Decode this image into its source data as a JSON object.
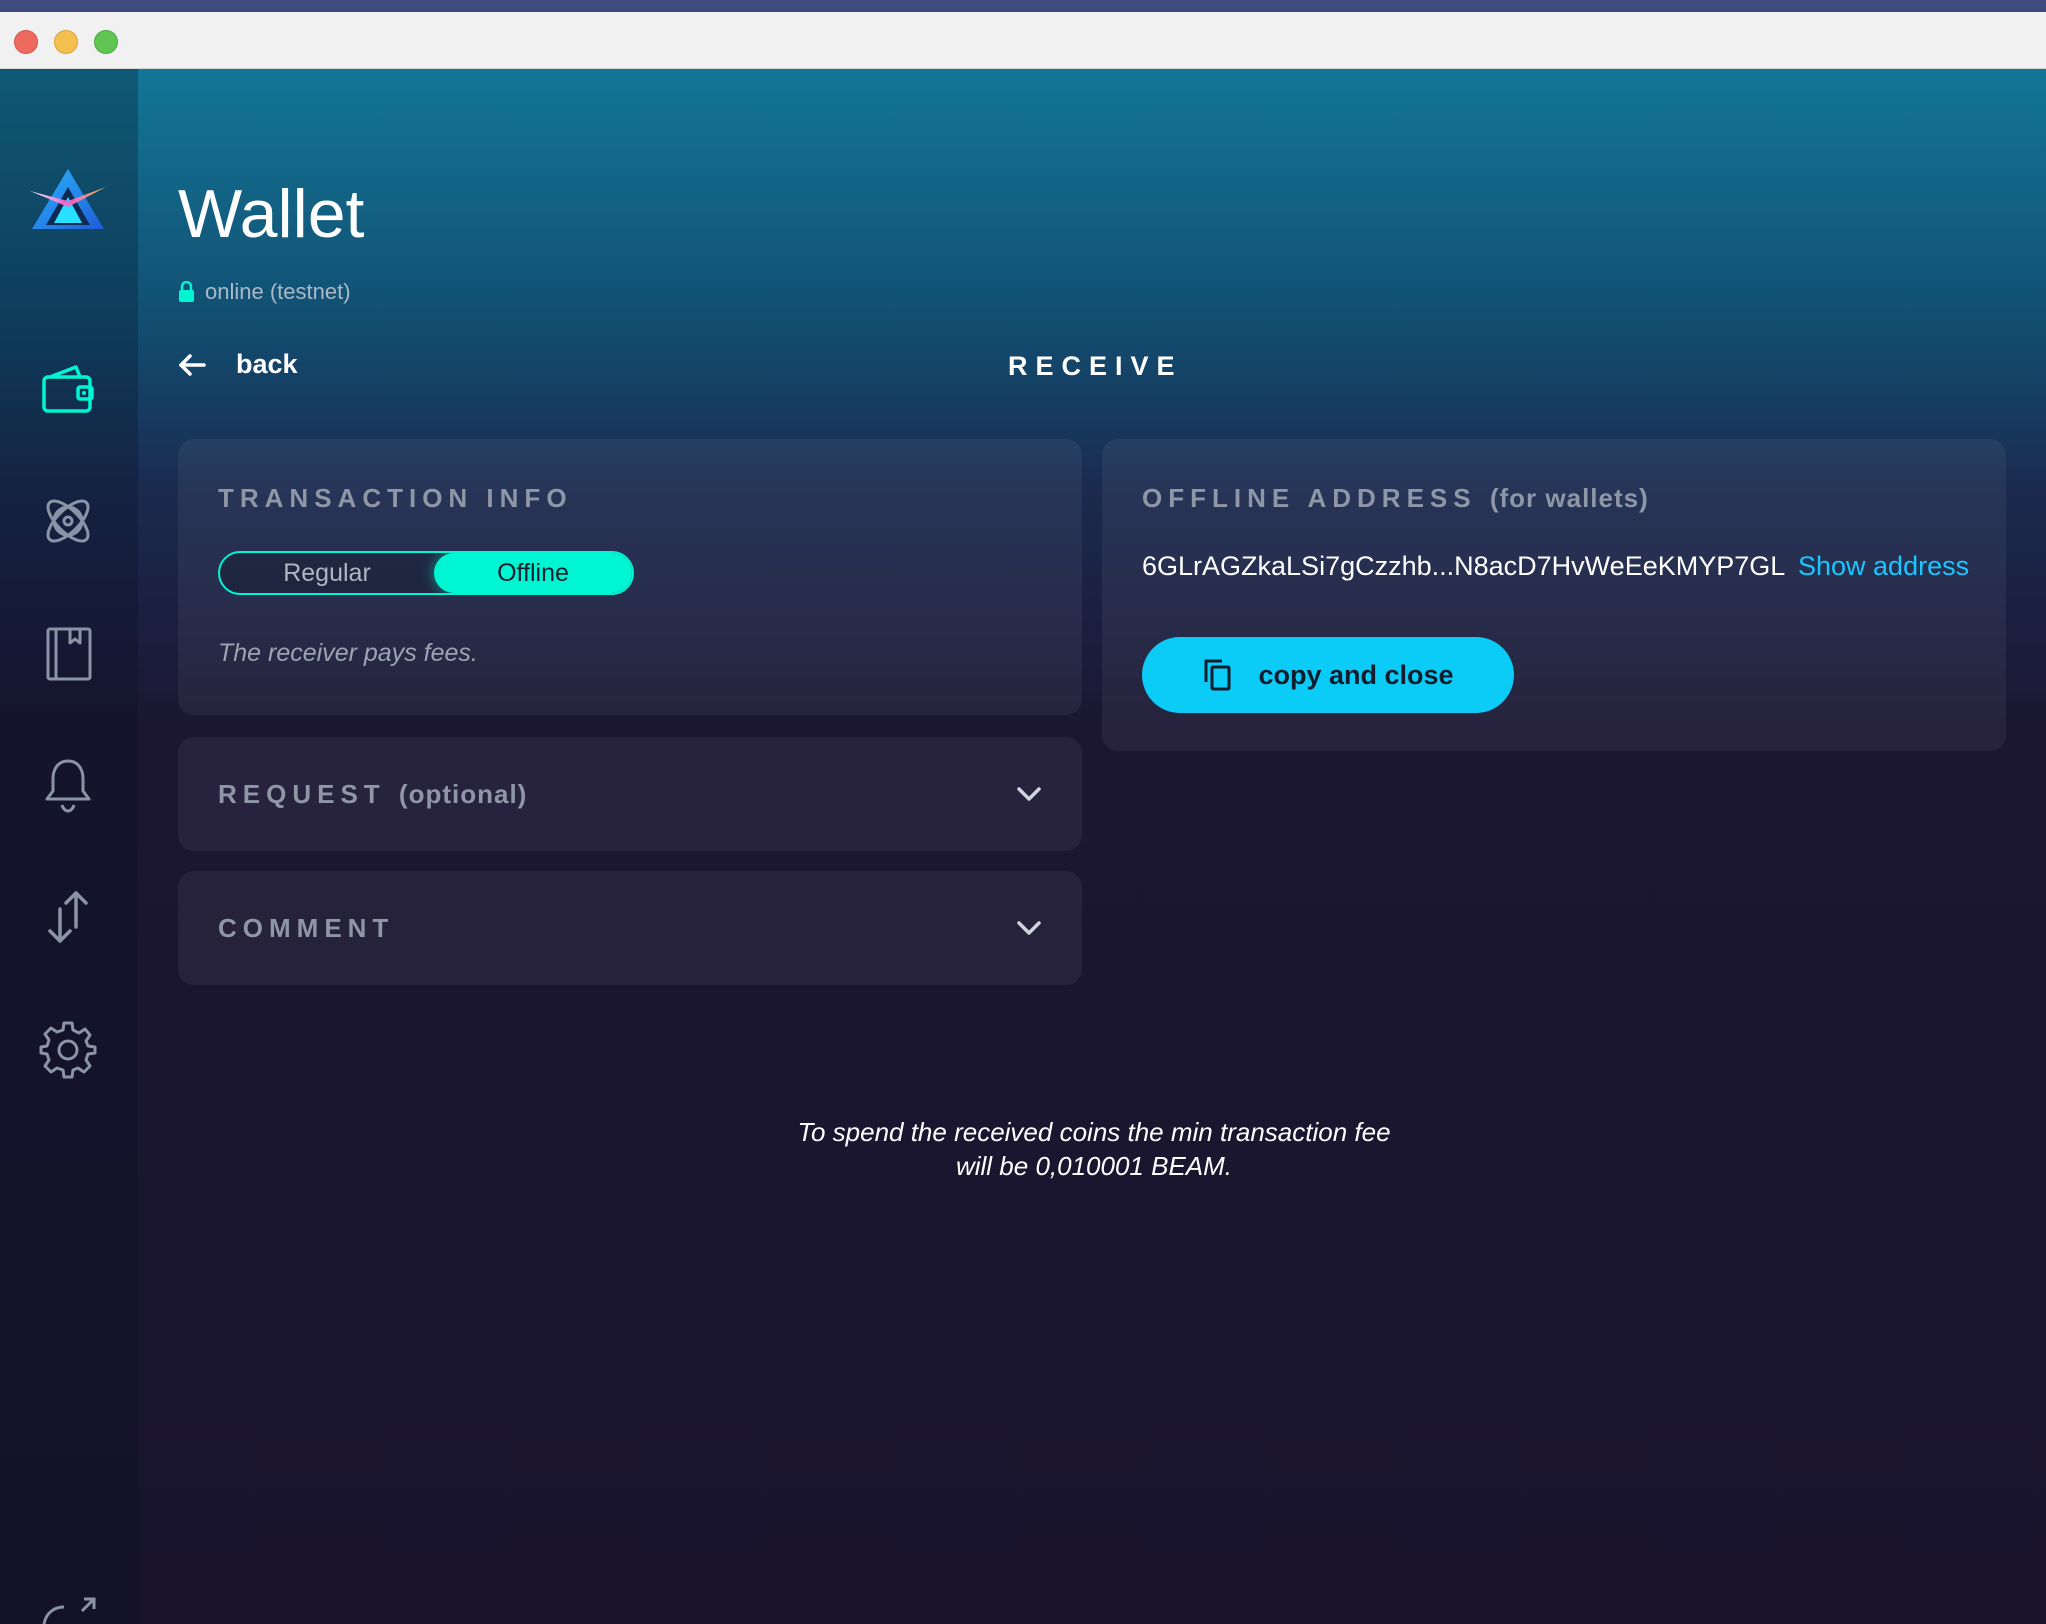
{
  "header": {
    "title": "Wallet",
    "status": "online (testnet)"
  },
  "nav": {
    "back_label": "back",
    "page_heading": "RECEIVE"
  },
  "sidebar": {
    "items": [
      {
        "icon": "wallet-icon",
        "active": true
      },
      {
        "icon": "atom-icon",
        "active": false
      },
      {
        "icon": "address-book-icon",
        "active": false
      },
      {
        "icon": "bell-icon",
        "active": false
      },
      {
        "icon": "transfer-arrows-icon",
        "active": false
      },
      {
        "icon": "gear-icon",
        "active": false
      }
    ]
  },
  "transaction_info": {
    "title": "TRANSACTION INFO",
    "toggle": {
      "options": [
        "Regular",
        "Offline"
      ],
      "selected": "Offline"
    },
    "note": "The receiver pays fees."
  },
  "request": {
    "title": "REQUEST",
    "suffix": "(optional)"
  },
  "comment": {
    "title": "COMMENT"
  },
  "offline_address": {
    "title": "OFFLINE ADDRESS",
    "suffix": "(for wallets)",
    "address": "6GLrAGZkaLSi7gCzzhb...N8acD7HvWeEeKMYP7GL",
    "show_address_label": "Show address",
    "copy_button_label": "copy and close"
  },
  "footer_note": {
    "line1": "To spend the received coins the min transaction fee",
    "line2": "will be 0,010001 BEAM."
  },
  "colors": {
    "accent": "#00f6d2",
    "button": "#0bccf7",
    "link": "#1ac6ff",
    "background": "#19142c"
  }
}
